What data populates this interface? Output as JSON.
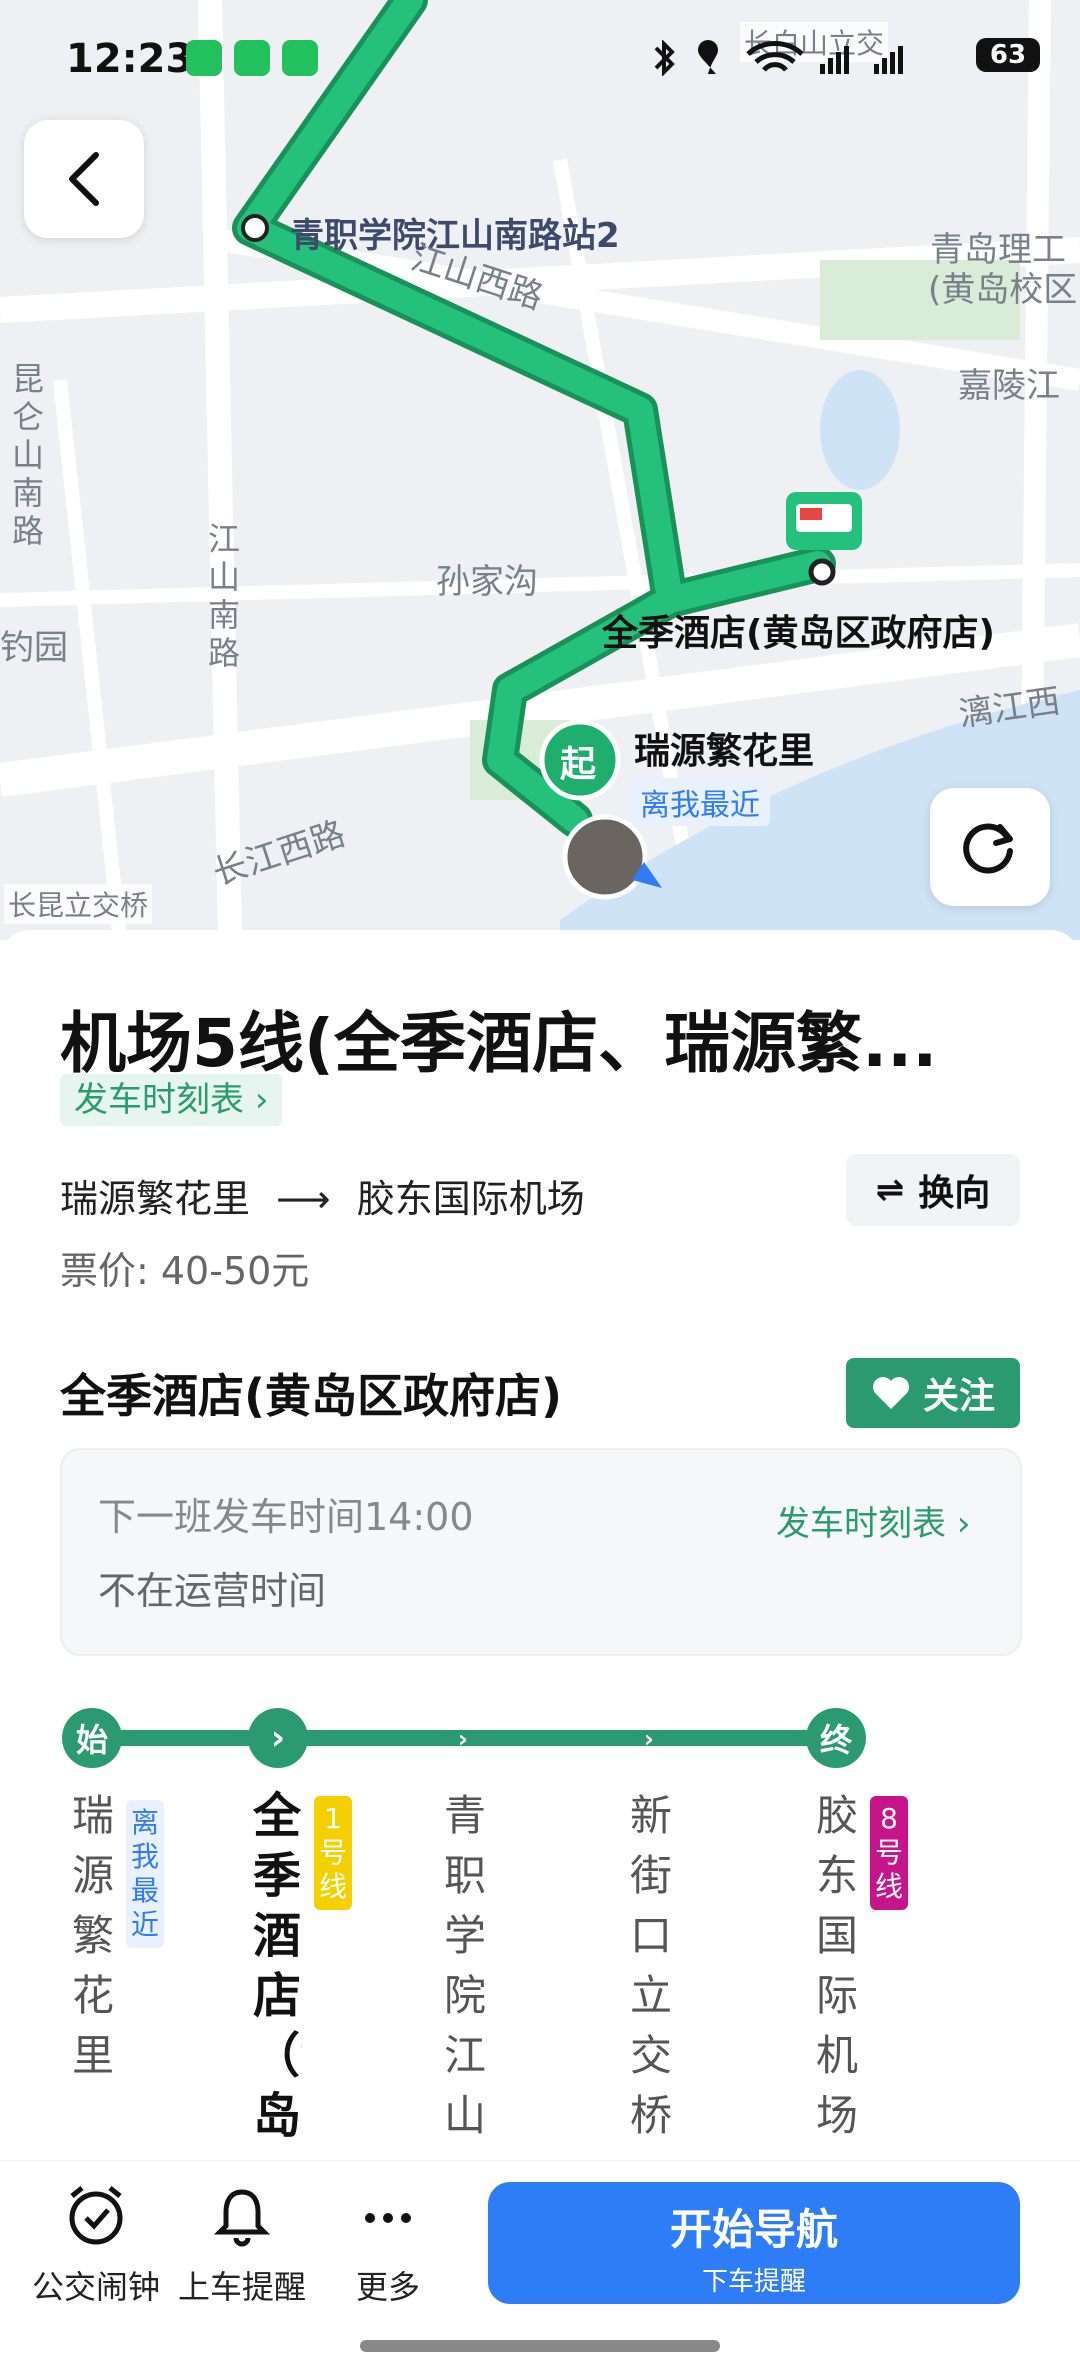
{
  "status": {
    "time": "12:23",
    "battery": "63"
  },
  "map": {
    "labels": {
      "station2": "青职学院江山南路站2",
      "jiangshan_w": "江山西路",
      "qingdao_tech": "青岛理工",
      "qingdao_tech_sub": "(黄岛校区",
      "jialing": "嘉陵江",
      "kunlun_road": "昆仑山南路",
      "jiangshan_south_road": "江山南路",
      "sunjiagou": "孙家沟",
      "hotel": "全季酒店(黄岛区政府店)",
      "diaoyuan": "钓园",
      "lijiang_w": "漓江西",
      "ruiyuan": "瑞源繁花里",
      "nearest": "离我最近",
      "start_marker": "起",
      "changjiang_w": "长江西路",
      "changkun_bridge": "长昆立交桥",
      "changbaishan": "长白山立交"
    }
  },
  "route": {
    "title": "机场5线(全季酒店、瑞源繁...",
    "schedule_link": "发车时刻表",
    "from": "瑞源繁花里",
    "to": "胶东国际机场",
    "price": "票价: 40-50元",
    "swap_label": "换向"
  },
  "stop": {
    "name": "全季酒店(黄岛区政府店)",
    "follow_label": "关注",
    "next_departure": "下一班发车时间14:00",
    "status": "不在运营时间",
    "timetable_link": "发车时刻表"
  },
  "timeline": {
    "start_label": "始",
    "end_label": "终",
    "stops": [
      {
        "name": "瑞源繁花里",
        "badge": "离我最近"
      },
      {
        "name": "全季酒店（黄岛",
        "badge": "1号线"
      },
      {
        "name": "青职学院江山",
        "badge": ""
      },
      {
        "name": "新街口立交桥",
        "badge": ""
      },
      {
        "name": "胶东国际机场",
        "badge": "8号线"
      }
    ]
  },
  "bottom_bar": {
    "alarm": "公交闹钟",
    "reminder": "上车提醒",
    "more": "更多",
    "nav_main": "开始导航",
    "nav_sub": "下车提醒"
  },
  "colors": {
    "route_green": "#1fae6e",
    "accent_green": "#2b9a71",
    "nav_blue": "#2f7df6",
    "line1_yellow": "#f5d000",
    "line8_magenta": "#c8148a"
  }
}
